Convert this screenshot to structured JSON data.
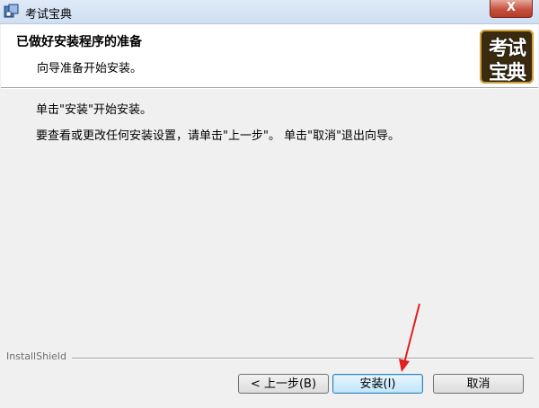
{
  "window": {
    "title": "考试宝典",
    "close_glyph": "X"
  },
  "header": {
    "title": "已做好安装程序的准备",
    "subtitle": "向导准备开始安装。",
    "logo_line1": "考试",
    "logo_line2": "宝典"
  },
  "body": {
    "line1": "单击\"安装\"开始安装。",
    "line2": "要查看或更改任何安装设置，请单击\"上一步\"。 单击\"取消\"退出向导。"
  },
  "footer": {
    "brand": "InstallShield",
    "back_label": "< 上一步(B)",
    "install_label": "安装(I)",
    "cancel_label": "取消"
  },
  "colors": {
    "annotation_arrow": "#e02020"
  }
}
